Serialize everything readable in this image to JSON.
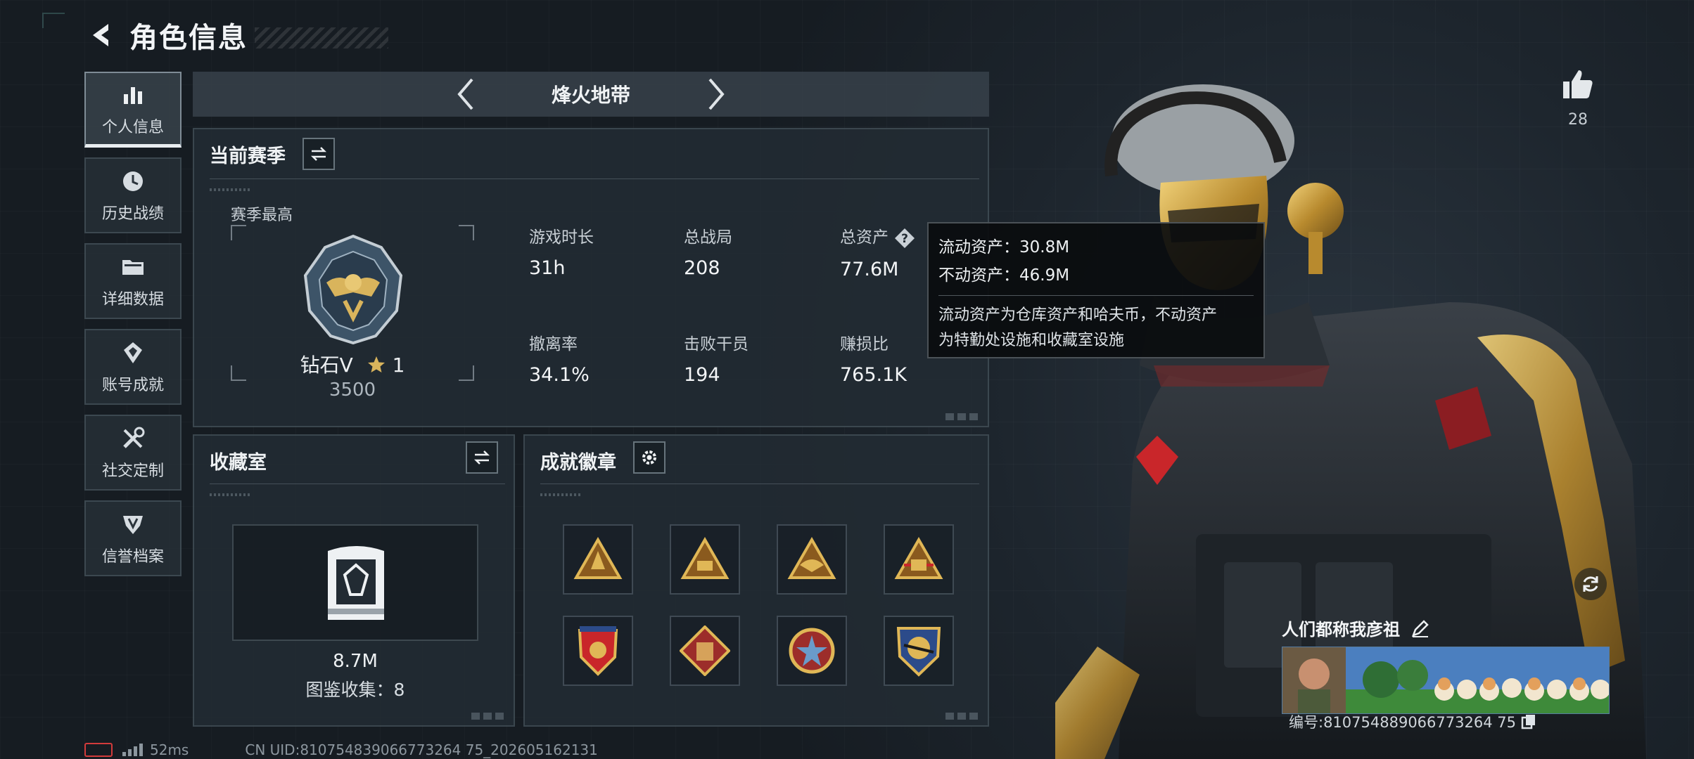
{
  "header": {
    "title": "角色信息"
  },
  "sidebar": {
    "items": [
      {
        "label": "个人信息",
        "icon": "bar-chart-icon",
        "active": true
      },
      {
        "label": "历史战绩",
        "icon": "history-clock-icon"
      },
      {
        "label": "详细数据",
        "icon": "folder-icon"
      },
      {
        "label": "账号成就",
        "icon": "achievement-icon"
      },
      {
        "label": "社交定制",
        "icon": "tools-icon"
      },
      {
        "label": "信誉档案",
        "icon": "credit-shield-icon"
      }
    ]
  },
  "mode": {
    "title": "烽火地带"
  },
  "season": {
    "title": "当前赛季",
    "best_label": "赛季最高",
    "rank_name": "钻石V",
    "rank_stars": "1",
    "rank_score": "3500",
    "stats": [
      {
        "key": "游戏时长",
        "value": "31h"
      },
      {
        "key": "总战局",
        "value": "208"
      },
      {
        "key": "总资产",
        "value": "77.6M"
      },
      {
        "key": "撤离率",
        "value": "34.1%"
      },
      {
        "key": "击败干员",
        "value": "194"
      },
      {
        "key": "赚损比",
        "value": "765.1K"
      }
    ]
  },
  "tooltip": {
    "liquid": "流动资产：30.8M",
    "fixed": "不动资产：46.9M",
    "desc_line1": "流动资产为仓库资产和哈夫币，不动资产",
    "desc_line2": "为特勤处设施和收藏室设施"
  },
  "collection": {
    "title": "收藏室",
    "value": "8.7M",
    "count": "图鉴收集：8"
  },
  "badges": {
    "title": "成就徽章",
    "items": [
      {
        "icon": "triangle-badge-icon"
      },
      {
        "icon": "triangle-50-badge-icon"
      },
      {
        "icon": "triangle-wing-badge-icon"
      },
      {
        "icon": "triangle-50-badge-icon"
      },
      {
        "icon": "shield-star-badge-icon"
      },
      {
        "icon": "diamond-vest-badge-icon"
      },
      {
        "icon": "round-star-badge-icon"
      },
      {
        "icon": "shield-rifle-badge-icon"
      }
    ]
  },
  "profile": {
    "likes": "28",
    "player_name": "人们都称我彦祖",
    "card_id": "编号:810754889066773264 75"
  },
  "status": {
    "ping": "52ms",
    "uid": "CN UID:810754839066773264 75_202605162131"
  },
  "colors": {
    "accent_gold": "#c9a14a",
    "panel_bg": "#222b33",
    "battery_red": "#d23b3b"
  }
}
